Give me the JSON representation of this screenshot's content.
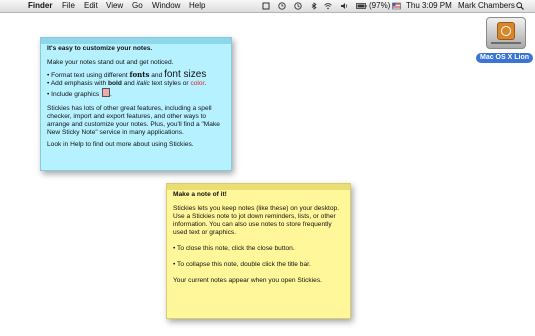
{
  "menubar": {
    "app": "Finder",
    "items": [
      "File",
      "Edit",
      "View",
      "Go",
      "Window",
      "Help"
    ],
    "battery": "(97%)",
    "clock": "Thu 3:09 PM",
    "user": "Mark Chambers"
  },
  "desktop": {
    "drive_label": "Mac OS X Lion"
  },
  "note_blue": {
    "title": "It's easy to customize your notes.",
    "intro": "Make your notes stand out and get noticed.",
    "bullet1_prefix": "• Format text using different ",
    "bullet1_fonts": "fonts",
    "bullet1_and": " and ",
    "bullet1_sizes": "font sizes",
    "bullet2_prefix": "• Add emphasis with ",
    "bullet2_bold": "bold",
    "bullet2_and": " and ",
    "bullet2_italic": "italic",
    "bullet2_mid": " text styles or ",
    "bullet2_color": "color",
    "bullet2_end": ".",
    "bullet3": "• Include graphics ",
    "bullet3_end": ".",
    "para": "Stickies has lots of other great features, including a spell checker, import and export features, and other ways to arrange and customize your notes. Plus, you'll find a \"Make New Sticky Note\" service in many applications.",
    "help": "Look in Help to find out more about using Stickies."
  },
  "note_yellow": {
    "title": "Make a note of it!",
    "para": "Stickies lets you keep notes (like these) on your desktop. Use a Stickies note to jot down reminders, lists, or other information. You can also use notes to store frequently used text or graphics.",
    "close_tip": "• To close this note, click the close button.",
    "collapse_tip": "• To collapse this note, double click the title bar.",
    "footer": "Your current notes appear when you open Stickies."
  },
  "colors": {
    "blue_note": "#b6f1ff",
    "yellow_note": "#fff79a",
    "selection": "#3a74d5"
  }
}
